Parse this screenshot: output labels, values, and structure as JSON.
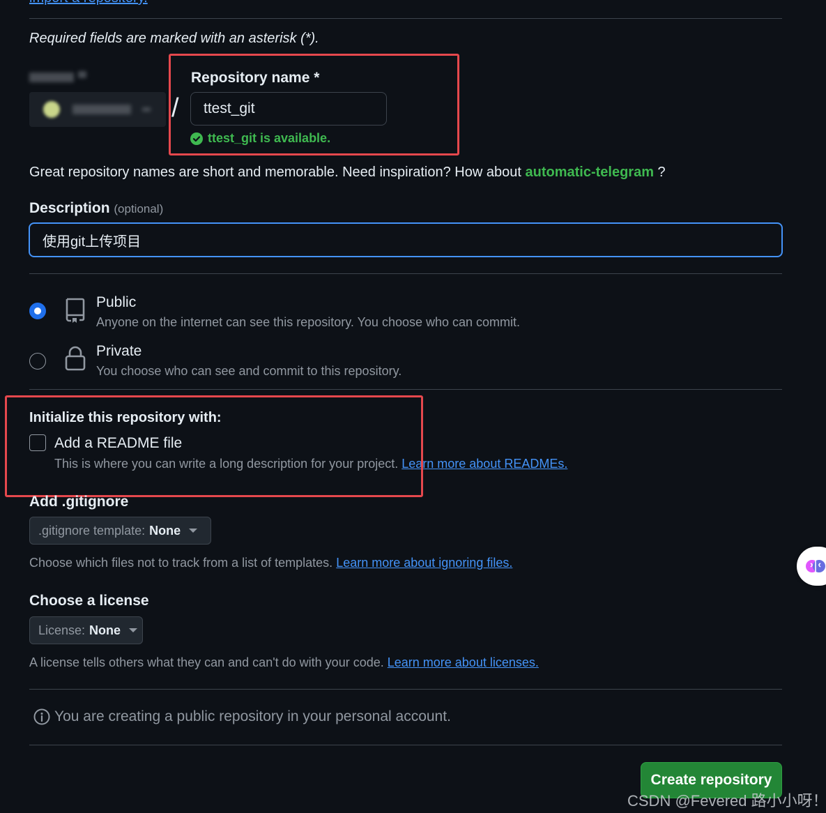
{
  "top_link": "import a repository.",
  "required_note": "Required fields are marked with an asterisk (*).",
  "owner": {
    "separator": "/"
  },
  "repo_name": {
    "label": "Repository name *",
    "value": "ttest_git",
    "availability": "ttest_git is available."
  },
  "suggestion": {
    "prefix": "Great repository names are short and memorable. Need inspiration? How about ",
    "name": "automatic-telegram",
    "suffix": " ?"
  },
  "description": {
    "label": "Description",
    "optional": "(optional)",
    "value": "使用git上传项目"
  },
  "visibility": [
    {
      "title": "Public",
      "desc": "Anyone on the internet can see this repository. You choose who can commit.",
      "selected": true
    },
    {
      "title": "Private",
      "desc": "You choose who can see and commit to this repository.",
      "selected": false
    }
  ],
  "init": {
    "heading": "Initialize this repository with:",
    "readme_label": "Add a README file",
    "readme_desc": "This is where you can write a long description for your project. ",
    "readme_link": "Learn more about READMEs."
  },
  "gitignore": {
    "heading": "Add .gitignore",
    "select_label": ".gitignore template:",
    "select_value": "None",
    "help": "Choose which files not to track from a list of templates. ",
    "help_link": "Learn more about ignoring files."
  },
  "license": {
    "heading": "Choose a license",
    "select_label": "License:",
    "select_value": "None",
    "help": "A license tells others what they can and can't do with your code. ",
    "help_link": "Learn more about licenses."
  },
  "info_note": "You are creating a public repository in your personal account.",
  "create_button": "Create repository",
  "watermark": "CSDN @Fevered 路小小呀！",
  "colors": {
    "accent_blue": "#4493f8",
    "success_green": "#3fb950",
    "button_green": "#238636",
    "highlight_red": "#e5484d"
  }
}
